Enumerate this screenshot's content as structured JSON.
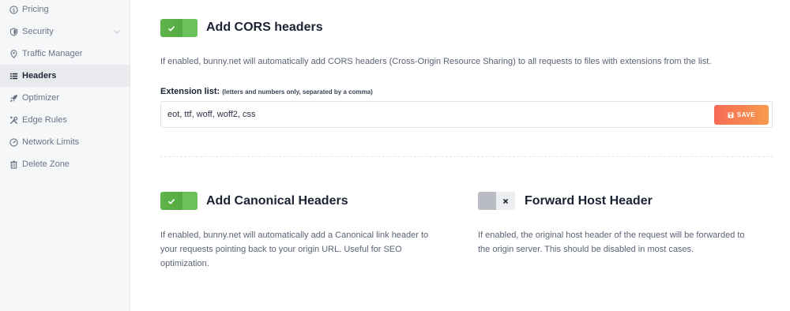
{
  "sidebar": {
    "items": [
      {
        "label": "Pricing",
        "icon": "dollar-icon",
        "active": false
      },
      {
        "label": "Security",
        "icon": "shield-icon",
        "active": false
      },
      {
        "label": "Traffic Manager",
        "icon": "map-pin-icon",
        "active": false
      },
      {
        "label": "Headers",
        "icon": "list-icon",
        "active": true
      },
      {
        "label": "Optimizer",
        "icon": "rocket-icon",
        "active": false
      },
      {
        "label": "Edge Rules",
        "icon": "tools-icon",
        "active": false
      },
      {
        "label": "Network Limits",
        "icon": "gauge-icon",
        "active": false
      },
      {
        "label": "Delete Zone",
        "icon": "trash-icon",
        "active": false
      }
    ]
  },
  "cors": {
    "title": "Add CORS headers",
    "enabled": true,
    "description": "If enabled, bunny.net will automatically add CORS headers (Cross-Origin Resource Sharing) to all requests to files with extensions from the list.",
    "extension_label": "Extension list:",
    "extension_hint": "(letters and numbers only, separated by a comma)",
    "extension_value": "eot, ttf, woff, woff2, css",
    "save_label": "SAVE"
  },
  "canonical": {
    "title": "Add Canonical Headers",
    "enabled": true,
    "description_lines": [
      "If enabled, bunny.net will automatically add a Canonical link header to",
      "your requests pointing back to your origin URL. Useful for SEO",
      "optimization."
    ]
  },
  "forward_host": {
    "title": "Forward Host Header",
    "enabled": false,
    "description_lines": [
      "If enabled, the original host header of the request will be forwarded to",
      "the origin server. This should be disabled in most cases."
    ]
  },
  "colors": {
    "toggle_on": "#5fb54c",
    "toggle_off": "#d6d8dc",
    "save_button": "#f6804f",
    "active_nav_bg": "#e8eaee"
  }
}
